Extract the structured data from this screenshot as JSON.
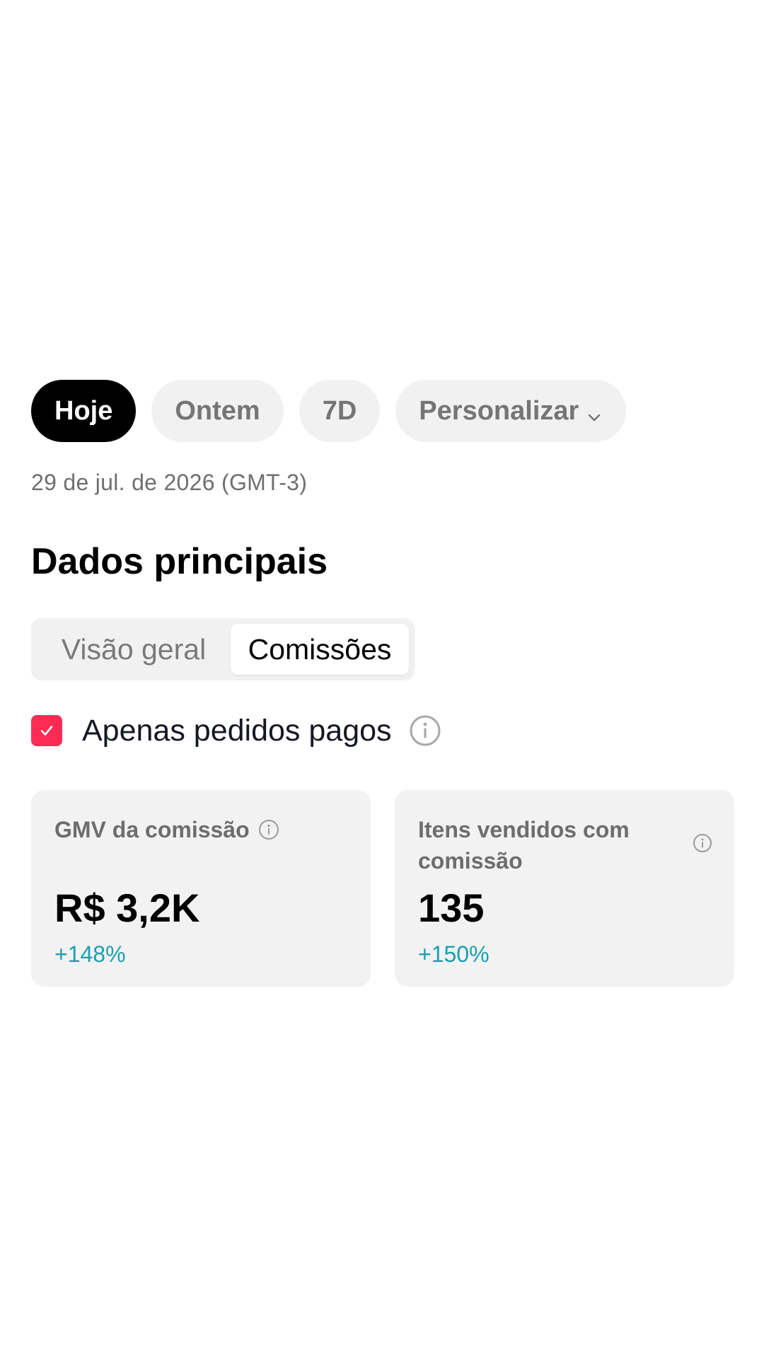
{
  "period_filter": {
    "options": [
      {
        "label": "Hoje",
        "selected": true
      },
      {
        "label": "Ontem",
        "selected": false
      },
      {
        "label": "7D",
        "selected": false
      },
      {
        "label": "Personalizar",
        "selected": false,
        "icon": "chevron-down-icon"
      }
    ]
  },
  "date_range": "29 de jul. de 2026 (GMT-3)",
  "section": {
    "title": "Dados principais"
  },
  "tabs": [
    {
      "label": "Visão geral",
      "selected": false
    },
    {
      "label": "Comissões",
      "selected": true
    }
  ],
  "filter": {
    "label": "Apenas pedidos pagos",
    "checked": true,
    "icon": "info-icon"
  },
  "metrics": [
    {
      "label": "GMV da comissão",
      "value": "R$ 3,2K",
      "change": "+148%",
      "icon": "info-icon"
    },
    {
      "label": "Itens vendidos com comissão",
      "value": "135",
      "change": "+150%",
      "icon": "info-icon"
    }
  ],
  "colors": {
    "accent": "#fe2c55",
    "positive_change": "#1a9fb1",
    "chip_active_bg": "#000000",
    "chip_inactive_bg": "#f1f1f2",
    "card_bg": "#f2f2f2"
  }
}
